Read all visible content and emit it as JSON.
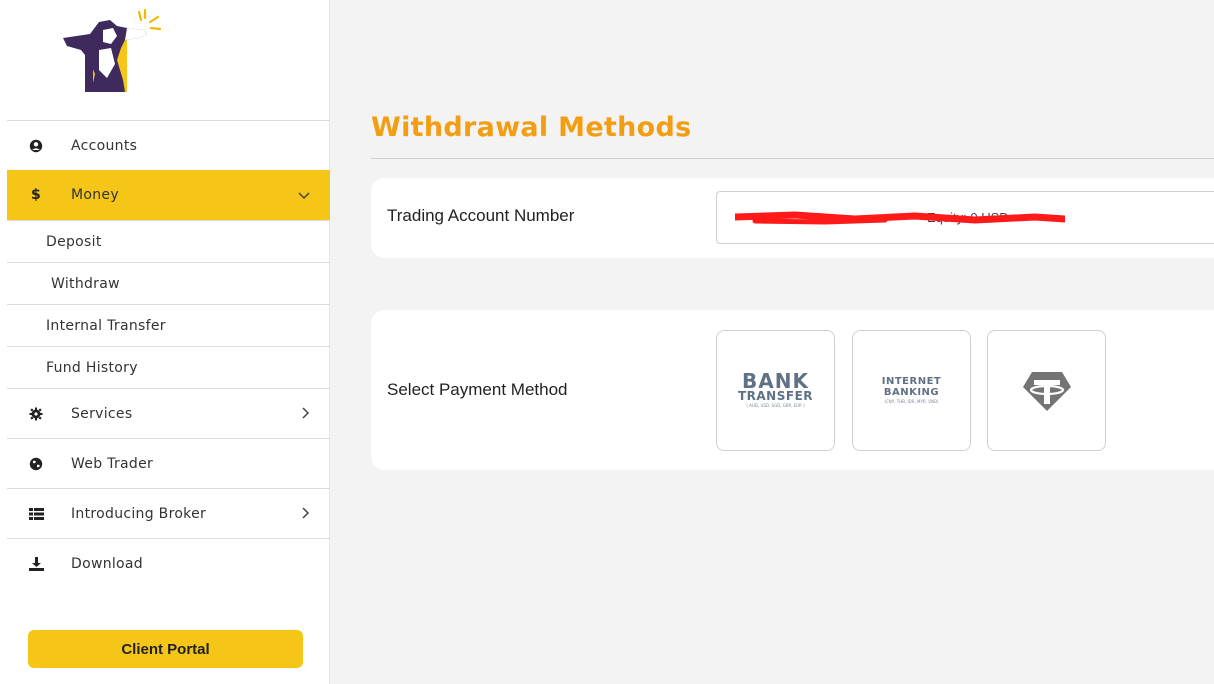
{
  "sidebar": {
    "items": [
      {
        "label": "Accounts",
        "icon": "user-circle-icon"
      },
      {
        "label": "Money",
        "icon": "dollar-icon"
      },
      {
        "label": "Services",
        "icon": "gear-icon"
      },
      {
        "label": "Web Trader",
        "icon": "globe-icon"
      },
      {
        "label": "Introducing Broker",
        "icon": "list-icon"
      },
      {
        "label": "Download",
        "icon": "download-icon"
      }
    ],
    "money_sub": [
      {
        "label": "Deposit"
      },
      {
        "label": "Withdraw"
      },
      {
        "label": "Internal Transfer"
      },
      {
        "label": "Fund History"
      }
    ],
    "client_portal_label": "Client Portal"
  },
  "main": {
    "title": "Withdrawal Methods",
    "trading_account_label": "Trading Account Number",
    "trading_account_value": "Equity: 0 USD",
    "payment_label": "Select Payment Method",
    "methods": {
      "bank": {
        "line1": "BANK",
        "line2": "TRANSFER",
        "line3": "( AUD, USD, SGD, GBP, EUR )"
      },
      "internet": {
        "line1": "INTERNET",
        "line2": "BANKING",
        "line3": "(CNY, THB, IDR, MYR, VND)"
      },
      "usdt": {
        "icon": "tether-icon"
      }
    }
  },
  "colors": {
    "accent": "#f5c518",
    "title": "#f29d12",
    "logo_icon": "#4a2b6e"
  }
}
